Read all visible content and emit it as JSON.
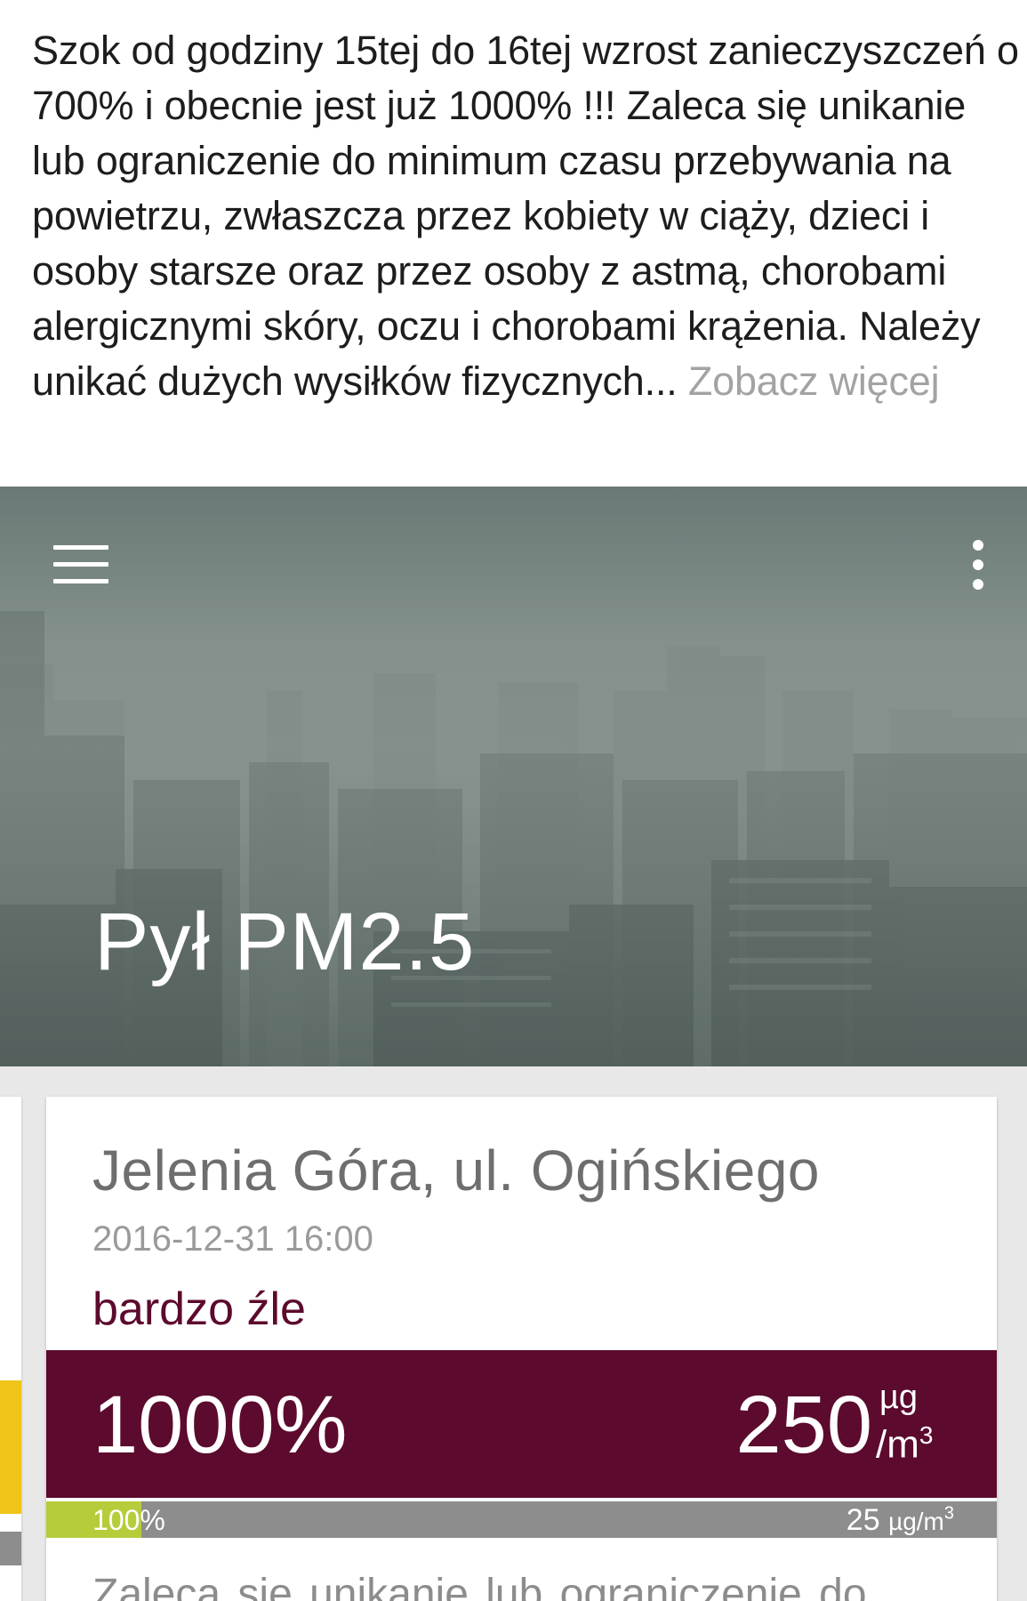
{
  "post": {
    "text": "Szok od godziny 15tej do 16tej wzrost zanieczyszczeń o 700% i obecnie jest już  1000% !!! Zaleca się unikanie lub ograniczenie do minimum czasu przebywania na powietrzu, zwłaszcza przez kobiety w ciąży, dzieci i osoby starsze oraz przez osoby z astmą, chorobami alergicznymi skóry, oczu i chorobami krążenia. Należy unikać dużych wysiłków fizycznych...",
    "see_more": "Zobacz więcej"
  },
  "app": {
    "title": "Pył PM2.5",
    "menu_icon": "hamburger-menu-icon",
    "overflow_icon": "vertical-dots-icon"
  },
  "card": {
    "station": "Jelenia Góra, ul. Ogińskiego",
    "datetime": "2016-12-31 16:00",
    "quality": "bardzo źle",
    "percent": "1000%",
    "concentration": "250",
    "unit_top": "µg",
    "unit_bottom": "/m",
    "unit_exp": "3",
    "norm_percent": "100%",
    "norm_fill": 0.1,
    "norm_value": "25",
    "norm_unit": "µg/m",
    "norm_unit_exp": "3",
    "advice": "Zaleca się unikanie lub ograniczenie do"
  },
  "colors": {
    "quality_very_bad": "#5c0a2e",
    "norm_fill": "#b6cc3b",
    "norm_bar": "#8d8d8d",
    "previous_card_accent": "#f0c419"
  }
}
